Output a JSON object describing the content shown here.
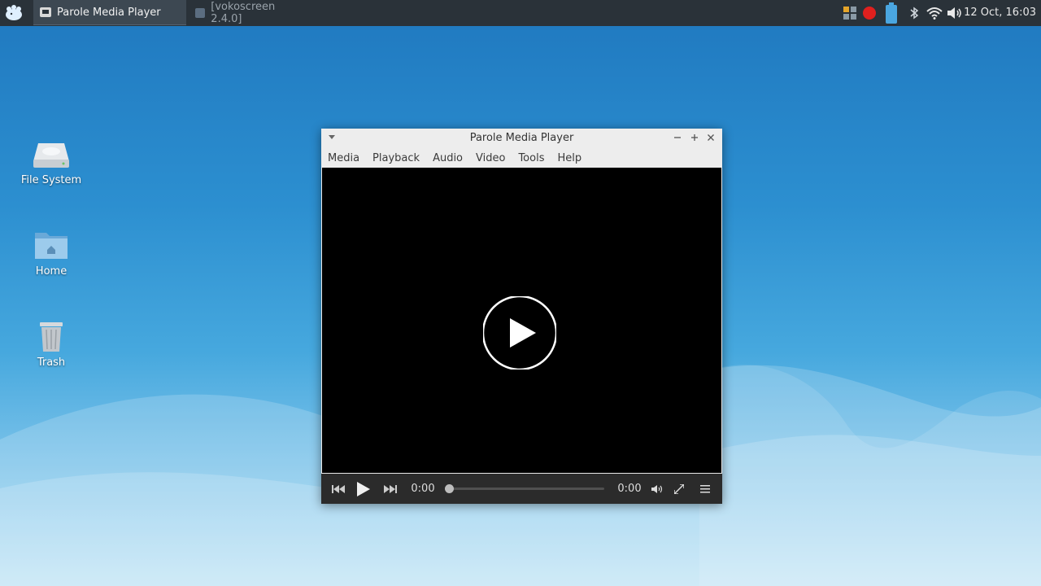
{
  "panel": {
    "tasks": [
      {
        "label": "Parole Media Player",
        "icon": "parole-icon",
        "active": true
      },
      {
        "label": "[vokoscreen 2.4.0]",
        "icon": "vokoscreen-icon",
        "active": false
      }
    ],
    "tray_icons": [
      "applet-grid-icon",
      "record-icon",
      "battery-icon",
      "bluetooth-icon",
      "wifi-icon",
      "volume-icon"
    ],
    "clock": "12 Oct, 16:03"
  },
  "desktop": {
    "icons": [
      {
        "label": "File System",
        "icon": "drive-icon"
      },
      {
        "label": "Home",
        "icon": "home-folder-icon"
      },
      {
        "label": "Trash",
        "icon": "trash-icon"
      }
    ]
  },
  "window": {
    "title": "Parole Media Player",
    "menu": [
      "Media",
      "Playback",
      "Audio",
      "Video",
      "Tools",
      "Help"
    ],
    "controls": {
      "elapsed": "0:00",
      "duration": "0:00",
      "progress": 0
    }
  },
  "colors": {
    "panel_bg": "#2a3239",
    "desktop_top": "#1f78bf",
    "desktop_bottom": "#b9e1f4",
    "record_red": "#e0201e",
    "battery_blue": "#4aa6e0"
  }
}
